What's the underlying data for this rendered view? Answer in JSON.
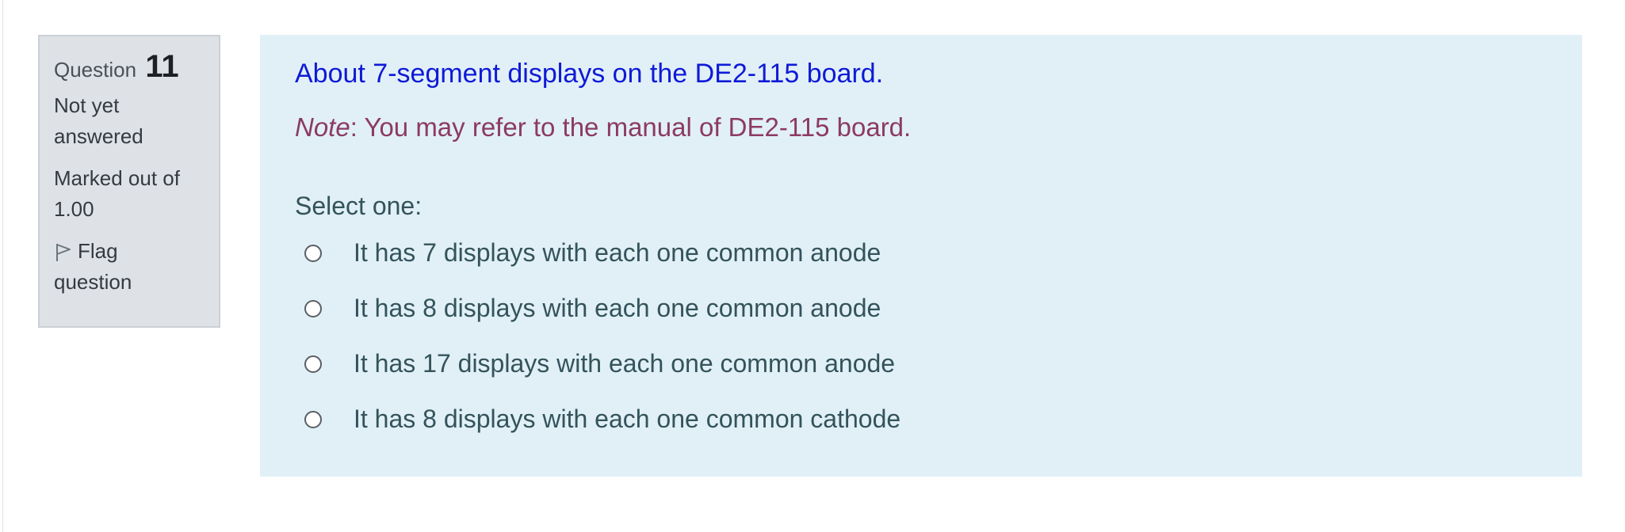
{
  "question_info": {
    "question_label": "Question",
    "question_number": "11",
    "state": "Not yet answered",
    "grade": "Marked out of 1.00",
    "flag_label": "Flag question",
    "flag_icon": "flag-outline-icon"
  },
  "question": {
    "title": "About 7-segment displays on the DE2-115 board.",
    "note_prefix": "Note",
    "note_text": ": You may refer to the manual of DE2-115 board.",
    "prompt": "Select one:",
    "options": [
      {
        "label": "It has 7 displays with each one common anode",
        "selected": false
      },
      {
        "label": "It has 8 displays with each one common anode",
        "selected": false
      },
      {
        "label": "It has 17 displays with each one common anode",
        "selected": false
      },
      {
        "label": "It has 8 displays with each one common cathode",
        "selected": false
      }
    ]
  },
  "colors": {
    "info_bg": "#dee2e6",
    "content_bg": "#e1f0f7",
    "title": "#0f1ad6",
    "note": "#8c3a63",
    "answer_text": "#34535b"
  }
}
